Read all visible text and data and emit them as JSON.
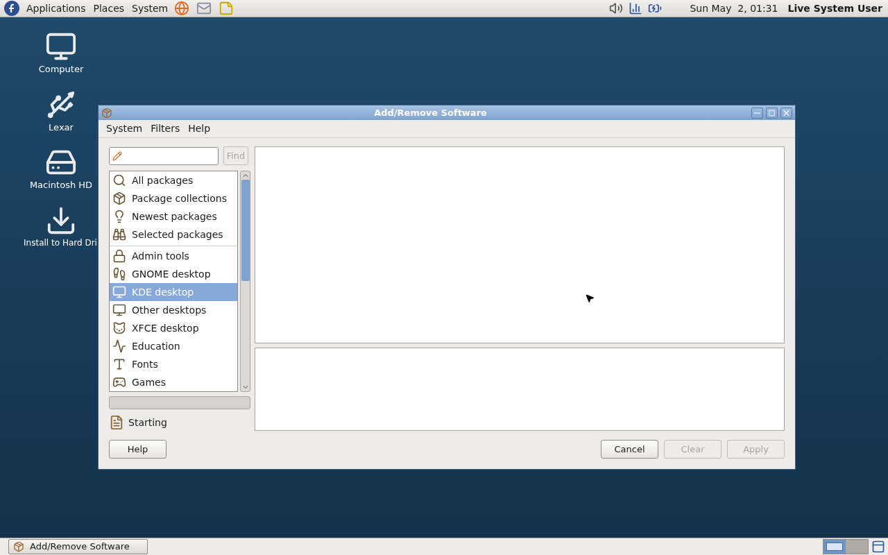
{
  "top_panel": {
    "menus": [
      {
        "label": "Applications"
      },
      {
        "label": "Places"
      },
      {
        "label": "System"
      }
    ],
    "clock": "Sun May  2, 01:31",
    "user": "Live System User"
  },
  "desktop_icons": [
    {
      "label": "Computer"
    },
    {
      "label": "Lexar"
    },
    {
      "label": "Macintosh HD"
    },
    {
      "label": "Install to Hard Dri"
    }
  ],
  "window": {
    "title": "Add/Remove Software",
    "menu": [
      "System",
      "Filters",
      "Help"
    ],
    "find_button": {
      "label": "Find",
      "disabled": true
    },
    "group_sections": [
      {
        "items": [
          {
            "label": "All packages",
            "selected": false
          },
          {
            "label": "Package collections",
            "selected": false
          },
          {
            "label": "Newest packages",
            "selected": false
          },
          {
            "label": "Selected packages",
            "selected": false
          }
        ]
      },
      {
        "items": [
          {
            "label": "Admin tools",
            "selected": false
          },
          {
            "label": "GNOME desktop",
            "selected": false
          },
          {
            "label": "KDE desktop",
            "selected": true
          },
          {
            "label": "Other desktops",
            "selected": false
          },
          {
            "label": "XFCE desktop",
            "selected": false
          },
          {
            "label": "Education",
            "selected": false
          },
          {
            "label": "Fonts",
            "selected": false
          },
          {
            "label": "Games",
            "selected": false
          }
        ]
      }
    ],
    "progress": {
      "level": 0
    },
    "status": "Starting",
    "help_button": {
      "label": "Help",
      "disabled": false
    },
    "buttons": [
      {
        "label": "Cancel",
        "disabled": false
      },
      {
        "label": "Clear",
        "disabled": true
      },
      {
        "label": "Apply",
        "disabled": true
      }
    ]
  },
  "taskbar": {
    "tasks": [
      {
        "label": "Add/Remove Software",
        "selected": false
      }
    ],
    "workspaces": [
      {
        "selected": true
      },
      {
        "selected": false
      }
    ]
  }
}
